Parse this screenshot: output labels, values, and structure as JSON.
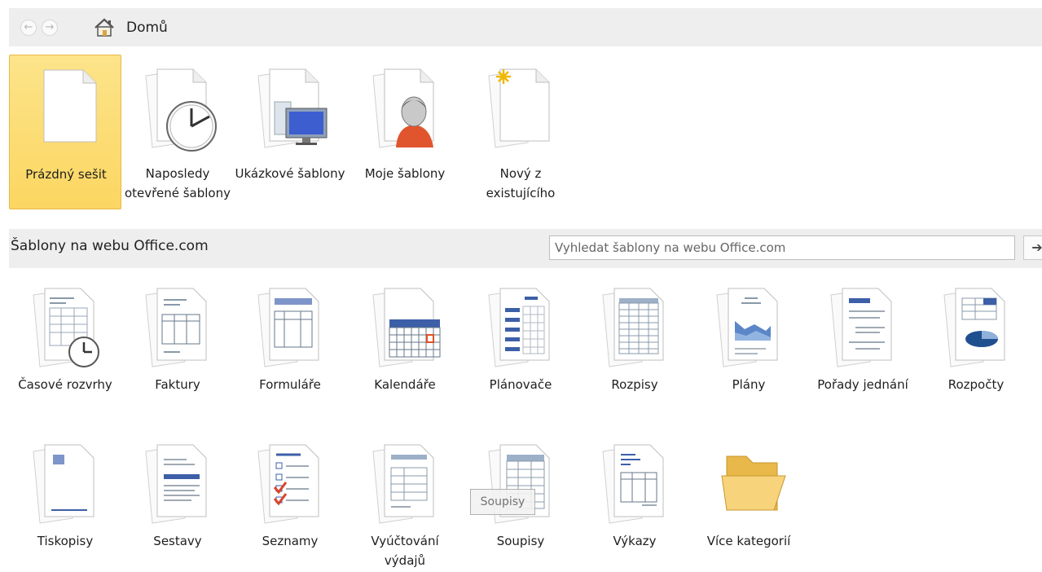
{
  "nav": {
    "back_glyph": "←",
    "forward_glyph": "→",
    "breadcrumb": "Domů",
    "home_icon": "home-icon"
  },
  "local_templates": [
    {
      "id": "blank",
      "label": "Prázdný sešit",
      "icon": "blank-workbook-icon",
      "selected": true
    },
    {
      "id": "recent",
      "label": "Naposledy otevřené šablony",
      "icon": "recent-templates-icon"
    },
    {
      "id": "sample",
      "label": "Ukázkové šablony",
      "icon": "sample-templates-icon"
    },
    {
      "id": "my",
      "label": "Moje šablony",
      "icon": "my-templates-icon"
    },
    {
      "id": "new-from-existing",
      "label": "Nový z existujícího",
      "icon": "new-from-existing-icon"
    }
  ],
  "office_section": {
    "title": "Šablony na webu Office.com",
    "search_placeholder": "Vyhledat šablony na webu Office.com",
    "go_glyph": "➔"
  },
  "office_categories_row1": [
    {
      "label": "Časové rozvrhy",
      "icon": "timesheets-icon"
    },
    {
      "label": "Faktury",
      "icon": "invoices-icon"
    },
    {
      "label": "Formuláře",
      "icon": "forms-icon"
    },
    {
      "label": "Kalendáře",
      "icon": "calendars-icon"
    },
    {
      "label": "Plánovače",
      "icon": "planners-icon"
    },
    {
      "label": "Rozpisy",
      "icon": "schedules-icon"
    },
    {
      "label": "Plány",
      "icon": "plans-icon"
    },
    {
      "label": "Pořady jednání",
      "icon": "agendas-icon"
    },
    {
      "label": "Rozpočty",
      "icon": "budgets-icon"
    }
  ],
  "office_categories_row2": [
    {
      "label": "Tiskopisy",
      "icon": "printed-forms-icon"
    },
    {
      "label": "Sestavy",
      "icon": "reports-icon"
    },
    {
      "label": "Seznamy",
      "icon": "lists-icon"
    },
    {
      "label": "Vyúčtování výdajů",
      "icon": "expense-reports-icon"
    },
    {
      "label": "Soupisy",
      "icon": "inventories-icon"
    },
    {
      "label": "Výkazy",
      "icon": "statements-icon"
    },
    {
      "label": "Více kategorií",
      "icon": "folder-icon"
    }
  ],
  "tooltip": "Soupisy",
  "colors": {
    "selected_bg": "#fbd661",
    "bar_bg": "#eeeeee",
    "accent_blue": "#3a6fb5"
  }
}
